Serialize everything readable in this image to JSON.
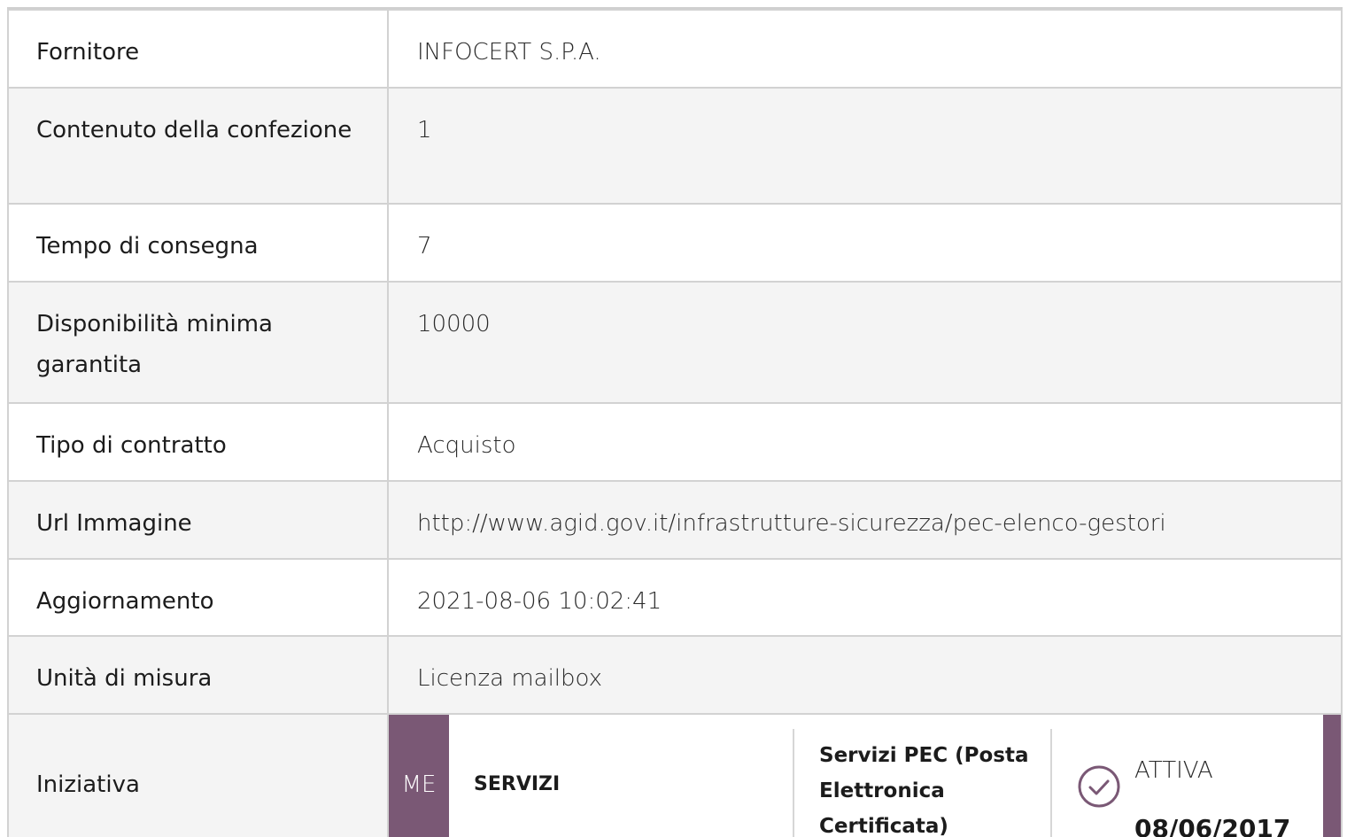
{
  "rows": [
    {
      "label": "Fornitore",
      "value": "INFOCERT S.P.A."
    },
    {
      "label": "Contenuto della confezione",
      "value": "1"
    },
    {
      "label": "Tempo di consegna",
      "value": "7"
    },
    {
      "label": "Disponibilità minima garantita",
      "value": "10000"
    },
    {
      "label": "Tipo di contratto",
      "value": "Acquisto"
    },
    {
      "label": "Url Immagine",
      "value": "http://www.agid.gov.it/infrastrutture-sicurezza/pec-elenco-gestori"
    },
    {
      "label": "Aggiornamento",
      "value": "2021-08-06 10:02:41"
    },
    {
      "label": "Unità di misura",
      "value": "Licenza mailbox"
    }
  ],
  "initiative": {
    "label": "Iniziativa",
    "badge": "ME",
    "type": "SERVIZI",
    "description": "Servizi PEC (Posta Elettronica Certificata)",
    "status": "ATTIVA",
    "date": "08/06/2017",
    "status_icon": "check-circle-icon",
    "accent_color": "#7a5875"
  }
}
